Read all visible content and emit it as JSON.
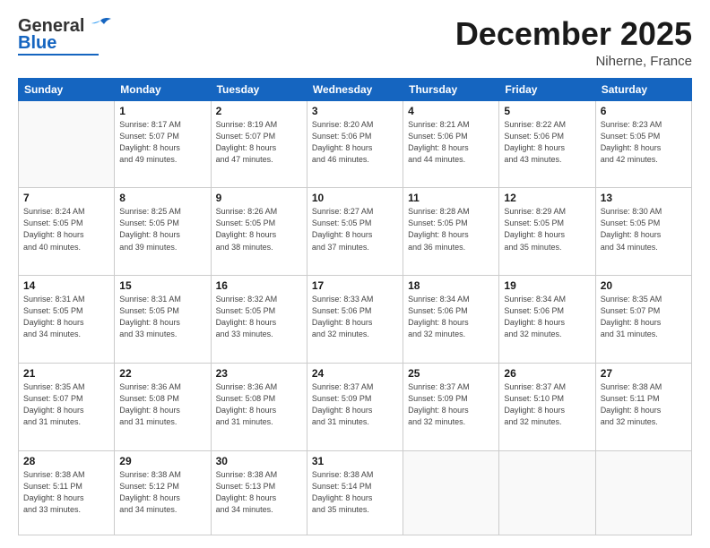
{
  "logo": {
    "general": "General",
    "blue": "Blue"
  },
  "header": {
    "month": "December 2025",
    "location": "Niherne, France"
  },
  "weekdays": [
    "Sunday",
    "Monday",
    "Tuesday",
    "Wednesday",
    "Thursday",
    "Friday",
    "Saturday"
  ],
  "weeks": [
    [
      {
        "day": "",
        "sunrise": "",
        "sunset": "",
        "daylight": ""
      },
      {
        "day": "1",
        "sunrise": "Sunrise: 8:17 AM",
        "sunset": "Sunset: 5:07 PM",
        "daylight": "Daylight: 8 hours and 49 minutes."
      },
      {
        "day": "2",
        "sunrise": "Sunrise: 8:19 AM",
        "sunset": "Sunset: 5:07 PM",
        "daylight": "Daylight: 8 hours and 47 minutes."
      },
      {
        "day": "3",
        "sunrise": "Sunrise: 8:20 AM",
        "sunset": "Sunset: 5:06 PM",
        "daylight": "Daylight: 8 hours and 46 minutes."
      },
      {
        "day": "4",
        "sunrise": "Sunrise: 8:21 AM",
        "sunset": "Sunset: 5:06 PM",
        "daylight": "Daylight: 8 hours and 44 minutes."
      },
      {
        "day": "5",
        "sunrise": "Sunrise: 8:22 AM",
        "sunset": "Sunset: 5:06 PM",
        "daylight": "Daylight: 8 hours and 43 minutes."
      },
      {
        "day": "6",
        "sunrise": "Sunrise: 8:23 AM",
        "sunset": "Sunset: 5:05 PM",
        "daylight": "Daylight: 8 hours and 42 minutes."
      }
    ],
    [
      {
        "day": "7",
        "sunrise": "Sunrise: 8:24 AM",
        "sunset": "Sunset: 5:05 PM",
        "daylight": "Daylight: 8 hours and 40 minutes."
      },
      {
        "day": "8",
        "sunrise": "Sunrise: 8:25 AM",
        "sunset": "Sunset: 5:05 PM",
        "daylight": "Daylight: 8 hours and 39 minutes."
      },
      {
        "day": "9",
        "sunrise": "Sunrise: 8:26 AM",
        "sunset": "Sunset: 5:05 PM",
        "daylight": "Daylight: 8 hours and 38 minutes."
      },
      {
        "day": "10",
        "sunrise": "Sunrise: 8:27 AM",
        "sunset": "Sunset: 5:05 PM",
        "daylight": "Daylight: 8 hours and 37 minutes."
      },
      {
        "day": "11",
        "sunrise": "Sunrise: 8:28 AM",
        "sunset": "Sunset: 5:05 PM",
        "daylight": "Daylight: 8 hours and 36 minutes."
      },
      {
        "day": "12",
        "sunrise": "Sunrise: 8:29 AM",
        "sunset": "Sunset: 5:05 PM",
        "daylight": "Daylight: 8 hours and 35 minutes."
      },
      {
        "day": "13",
        "sunrise": "Sunrise: 8:30 AM",
        "sunset": "Sunset: 5:05 PM",
        "daylight": "Daylight: 8 hours and 34 minutes."
      }
    ],
    [
      {
        "day": "14",
        "sunrise": "Sunrise: 8:31 AM",
        "sunset": "Sunset: 5:05 PM",
        "daylight": "Daylight: 8 hours and 34 minutes."
      },
      {
        "day": "15",
        "sunrise": "Sunrise: 8:31 AM",
        "sunset": "Sunset: 5:05 PM",
        "daylight": "Daylight: 8 hours and 33 minutes."
      },
      {
        "day": "16",
        "sunrise": "Sunrise: 8:32 AM",
        "sunset": "Sunset: 5:05 PM",
        "daylight": "Daylight: 8 hours and 33 minutes."
      },
      {
        "day": "17",
        "sunrise": "Sunrise: 8:33 AM",
        "sunset": "Sunset: 5:06 PM",
        "daylight": "Daylight: 8 hours and 32 minutes."
      },
      {
        "day": "18",
        "sunrise": "Sunrise: 8:34 AM",
        "sunset": "Sunset: 5:06 PM",
        "daylight": "Daylight: 8 hours and 32 minutes."
      },
      {
        "day": "19",
        "sunrise": "Sunrise: 8:34 AM",
        "sunset": "Sunset: 5:06 PM",
        "daylight": "Daylight: 8 hours and 32 minutes."
      },
      {
        "day": "20",
        "sunrise": "Sunrise: 8:35 AM",
        "sunset": "Sunset: 5:07 PM",
        "daylight": "Daylight: 8 hours and 31 minutes."
      }
    ],
    [
      {
        "day": "21",
        "sunrise": "Sunrise: 8:35 AM",
        "sunset": "Sunset: 5:07 PM",
        "daylight": "Daylight: 8 hours and 31 minutes."
      },
      {
        "day": "22",
        "sunrise": "Sunrise: 8:36 AM",
        "sunset": "Sunset: 5:08 PM",
        "daylight": "Daylight: 8 hours and 31 minutes."
      },
      {
        "day": "23",
        "sunrise": "Sunrise: 8:36 AM",
        "sunset": "Sunset: 5:08 PM",
        "daylight": "Daylight: 8 hours and 31 minutes."
      },
      {
        "day": "24",
        "sunrise": "Sunrise: 8:37 AM",
        "sunset": "Sunset: 5:09 PM",
        "daylight": "Daylight: 8 hours and 31 minutes."
      },
      {
        "day": "25",
        "sunrise": "Sunrise: 8:37 AM",
        "sunset": "Sunset: 5:09 PM",
        "daylight": "Daylight: 8 hours and 32 minutes."
      },
      {
        "day": "26",
        "sunrise": "Sunrise: 8:37 AM",
        "sunset": "Sunset: 5:10 PM",
        "daylight": "Daylight: 8 hours and 32 minutes."
      },
      {
        "day": "27",
        "sunrise": "Sunrise: 8:38 AM",
        "sunset": "Sunset: 5:11 PM",
        "daylight": "Daylight: 8 hours and 32 minutes."
      }
    ],
    [
      {
        "day": "28",
        "sunrise": "Sunrise: 8:38 AM",
        "sunset": "Sunset: 5:11 PM",
        "daylight": "Daylight: 8 hours and 33 minutes."
      },
      {
        "day": "29",
        "sunrise": "Sunrise: 8:38 AM",
        "sunset": "Sunset: 5:12 PM",
        "daylight": "Daylight: 8 hours and 34 minutes."
      },
      {
        "day": "30",
        "sunrise": "Sunrise: 8:38 AM",
        "sunset": "Sunset: 5:13 PM",
        "daylight": "Daylight: 8 hours and 34 minutes."
      },
      {
        "day": "31",
        "sunrise": "Sunrise: 8:38 AM",
        "sunset": "Sunset: 5:14 PM",
        "daylight": "Daylight: 8 hours and 35 minutes."
      },
      {
        "day": "",
        "sunrise": "",
        "sunset": "",
        "daylight": ""
      },
      {
        "day": "",
        "sunrise": "",
        "sunset": "",
        "daylight": ""
      },
      {
        "day": "",
        "sunrise": "",
        "sunset": "",
        "daylight": ""
      }
    ]
  ]
}
